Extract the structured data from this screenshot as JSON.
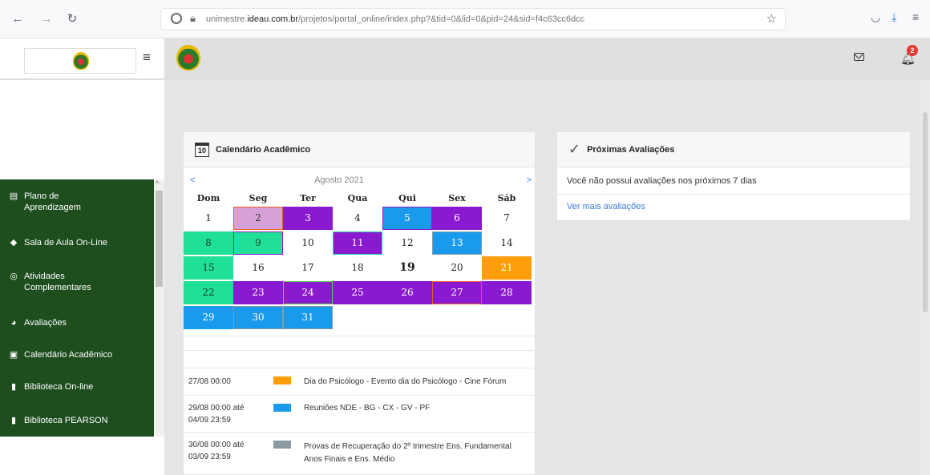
{
  "browser": {
    "url_prefix": "unimestre.",
    "url_domain": "ideau.com.br",
    "url_path": "/projetos/portal_online/index.php?&tid=0&lid=0&pid=24&sid=f4c63cc6dcc"
  },
  "header": {
    "notification_count": "2"
  },
  "sidebar": {
    "items": [
      {
        "label": "Plano de Aprendizagem",
        "icon": "document-icon"
      },
      {
        "label": "Sala de Aula On-Line",
        "icon": "graduation-cap-icon"
      },
      {
        "label": "Atividades Complementares",
        "icon": "circle-arrow-icon"
      },
      {
        "label": "Avaliações",
        "icon": "pie-chart-icon"
      },
      {
        "label": "Calendário Acadêmico",
        "icon": "calendar-check-icon"
      },
      {
        "label": "Biblioteca On-line",
        "icon": "book-icon"
      },
      {
        "label": "Biblioteca PEARSON",
        "icon": "book-icon"
      }
    ]
  },
  "calendar": {
    "title": "Calendário Acadêmico",
    "icon_day": "10",
    "prev": "<",
    "next": ">",
    "month": "Agosto 2021",
    "weekdays": [
      "Dom",
      "Seg",
      "Ter",
      "Qua",
      "Qui",
      "Sex",
      "Sáb"
    ],
    "weeks": [
      [
        {
          "d": "1"
        },
        {
          "d": "2",
          "c": "pink",
          "b": "orange"
        },
        {
          "d": "3",
          "c": "purple"
        },
        {
          "d": "4"
        },
        {
          "d": "5",
          "c": "blue",
          "b": "purple"
        },
        {
          "d": "6",
          "c": "purple"
        },
        {
          "d": "7"
        }
      ],
      [
        {
          "d": "8",
          "c": "green"
        },
        {
          "d": "9",
          "c": "green",
          "b": "purple"
        },
        {
          "d": "10"
        },
        {
          "d": "11",
          "c": "purple",
          "b": "teal"
        },
        {
          "d": "12"
        },
        {
          "d": "13",
          "c": "blue",
          "b": "gray"
        },
        {
          "d": "14"
        }
      ],
      [
        {
          "d": "15",
          "c": "green"
        },
        {
          "d": "16"
        },
        {
          "d": "17"
        },
        {
          "d": "18"
        },
        {
          "d": "19",
          "today": true
        },
        {
          "d": "20"
        },
        {
          "d": "21",
          "c": "orange"
        }
      ],
      [
        {
          "d": "22",
          "c": "green"
        },
        {
          "d": "23",
          "c": "purple"
        },
        {
          "d": "24",
          "c": "purple",
          "b": "green"
        },
        {
          "d": "25",
          "c": "purple"
        },
        {
          "d": "26",
          "c": "purple"
        },
        {
          "d": "27",
          "c": "purple",
          "b": "orange"
        },
        {
          "d": "28",
          "c": "purple"
        }
      ],
      [
        {
          "d": "29",
          "c": "blue"
        },
        {
          "d": "30",
          "c": "blue",
          "b": "gray"
        },
        {
          "d": "31",
          "c": "blue",
          "b": "gray"
        },
        {
          "d": ""
        },
        {
          "d": ""
        },
        {
          "d": ""
        },
        {
          "d": ""
        }
      ]
    ],
    "events": [
      {
        "date": "27/08 00:00",
        "color": "#ff9d0a",
        "text": "Dia do Psicólogo - Evento dia do Psicólogo - Cine Fórum"
      },
      {
        "date": "29/08 00:00 até\n04/09 23:59",
        "color": "#1a9aec",
        "text": "Reuniões NDE - BG - CX - GV - PF"
      },
      {
        "date": "30/08 00:00 até\n03/09 23:59",
        "color": "#8a9aa0",
        "text": "Provas de Recuperação do 2º trimestre Ens. Fundamental\nAnos Finais e Ens. Médio"
      }
    ]
  },
  "evaluations": {
    "title": "Próximas Avaliações",
    "empty_text": "Você não possui avaliações nos próximos 7 dias",
    "more_link": "Ver mais avaliações"
  }
}
